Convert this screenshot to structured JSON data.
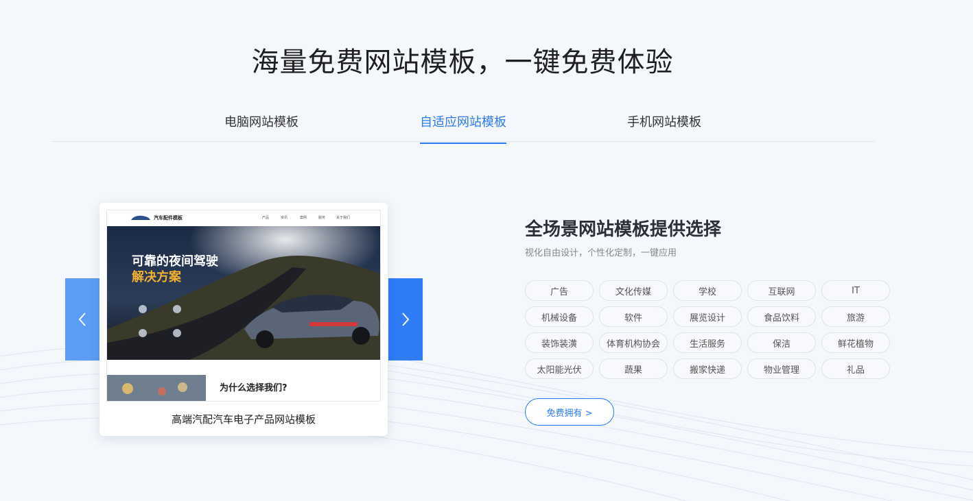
{
  "header": {
    "title": "海量免费网站模板，一键免费体验"
  },
  "tabs": [
    {
      "label": "电脑网站模板",
      "active": false
    },
    {
      "label": "自适应网站模板",
      "active": true
    },
    {
      "label": "手机网站模板",
      "active": false
    }
  ],
  "carousel": {
    "prev_icon": "chevron-left-icon",
    "next_icon": "chevron-right-icon",
    "card": {
      "caption": "高端汽配汽车电子产品网站模板",
      "preview": {
        "brand": "汽车配件模板",
        "nav": [
          "产品",
          "资讯",
          "案例",
          "服务",
          "关于我们"
        ],
        "hero_line1": "可靠的夜间驾驶",
        "hero_line2": "解决方案",
        "why_title": "为什么选择我们?"
      }
    }
  },
  "side": {
    "title": "全场景网站模板提供选择",
    "subtitle": "视化自由设计，个性化定制，一键应用",
    "tags": [
      "广告",
      "文化传媒",
      "学校",
      "互联网",
      "IT",
      "机械设备",
      "软件",
      "展览设计",
      "食品饮料",
      "旅游",
      "装饰装潢",
      "体育机构协会",
      "生活服务",
      "保洁",
      "鲜花植物",
      "太阳能光伏",
      "蔬果",
      "搬家快递",
      "物业管理",
      "礼品"
    ],
    "cta": "免费拥有 >"
  },
  "colors": {
    "accent": "#2a7bf0",
    "background": "#f4f7fb"
  }
}
